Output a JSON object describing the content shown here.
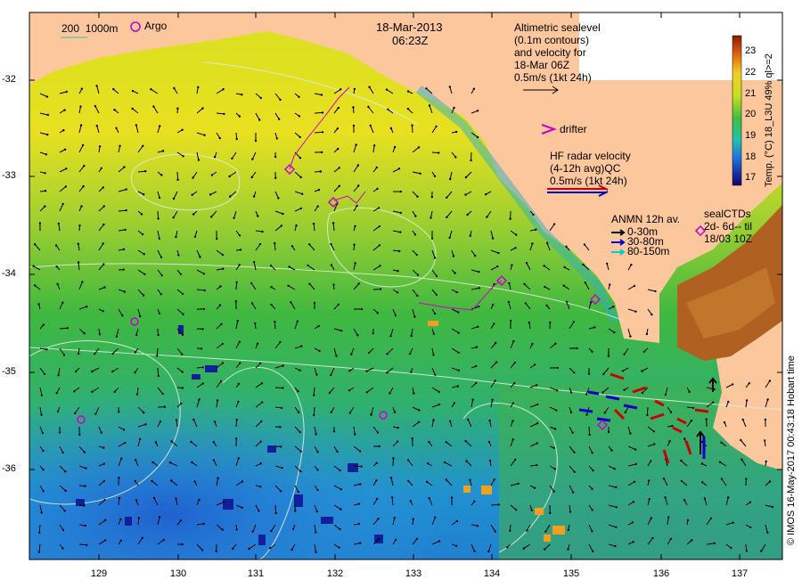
{
  "map": {
    "date": "18-Mar-2013",
    "time": "06:23Z",
    "bathy_legend": "200  1000m",
    "argo_label": "Argo",
    "altimetry_note": "Altimetric sealevel\n(0.1m contours)\nand velocity for\n18-Mar 06Z\n0.5m/s (1kt 24h)",
    "drifter_label": "drifter",
    "hf_radar_note": "HF radar velocity\n(4-12h avg)QC\n0.5m/s (1kt 24h)",
    "anmn_title": "ANMN 12h av.",
    "anmn_depths": [
      "0-30m",
      "30-80m",
      "80-150m"
    ],
    "anmn_colors": [
      "#000000",
      "#0000cc",
      "#00cccc"
    ],
    "sealctd_note": "sealCTDs\n2d- 6d-- til\n18/03 10Z",
    "colorbar_label": "Temp. (°C) 18_L3U 49% ql>=2",
    "colorbar_ticks": [
      "23",
      "22",
      "21",
      "20",
      "19",
      "18",
      "17"
    ],
    "credit": "© IMOS 16-May-2017 00:43:18 Hobart time",
    "lat_ticks": [
      "-32",
      "-33",
      "-34",
      "-35",
      "-36"
    ],
    "lon_ticks": [
      "129",
      "130",
      "131",
      "132",
      "133",
      "134",
      "135",
      "136",
      "137"
    ],
    "colors": {
      "land": "#fcc79c",
      "sst_warm": "#f0e020",
      "sst_mid": "#40c040",
      "sst_cool": "#2090e0",
      "argo": "#cc00cc",
      "contour": "#ddeedd"
    }
  }
}
